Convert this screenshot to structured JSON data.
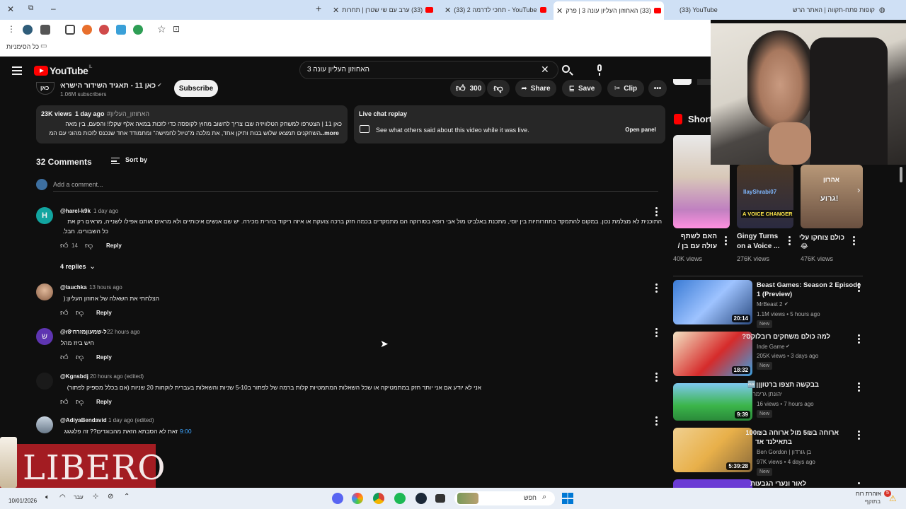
{
  "browser": {
    "tabs": [
      {
        "label": "קופות פתח-תקווה | האתר הרש"
      },
      {
        "label": "(33) YouTube"
      },
      {
        "label": "(33) האחוזון העליון עונה 3 | פרק"
      },
      {
        "label": "(33) תחכי לדרמה 2 - YouTube"
      },
      {
        "label": "(33) ערב עם שי שטרן | תחרות"
      }
    ],
    "bookmarks_label": "כל הסימניות"
  },
  "youtube": {
    "logo_text": "YouTube",
    "logo_region": "IL",
    "search_value": "האחוזון העליון עונה 3"
  },
  "channel": {
    "name": "כאן 11 - תאגיד השידור הישראלי",
    "subscribers": "1.06M subscribers",
    "subscribe_label": "Subscribe",
    "logo_text": "כאן"
  },
  "actions": {
    "likes": "300",
    "share": "Share",
    "save": "Save",
    "clip": "Clip"
  },
  "description": {
    "views": "23K views",
    "age": "1 day ago",
    "hashtag": "#האחוזון_העליון",
    "line1": "כאן 11 | הצטרפו למשחק הטלוויזיה שבו צריך לחשוב מחוץ לקופסה כדי לזכות במאה אלף שקל!! והפעם, בין מאה",
    "line2": "השחקנים תמצאו שלוש בנות ותיקן אחד, את מלכה מ\"טיול לחמישה\" ומתמודד אחד שנכנס לזכות מהוני עם המ",
    "more": "...more"
  },
  "live_chat": {
    "title": "Live chat replay",
    "text": "See what others said about this video while it was live.",
    "button": "Open panel"
  },
  "comments": {
    "count_label": "32 Comments",
    "sort_label": "Sort by",
    "add_placeholder": "Add a comment...",
    "reply_label": "Reply",
    "items": [
      {
        "author": "@harel-k9k",
        "age": "1 day ago",
        "avatar_letter": "H",
        "avatar_color": "#12a5a0",
        "text1": "התוכנית לא מצלמת נכון. במקום להתמקד בתחרותיות בין יוסי, מתכנת באלביט מול אבי רופא בסורוקה הם מתמקדים בכמה חזק ברכה צועקת או איזה ריקוד בהרית מכירה. יש שם אנשים איכותיים ולא מראים אותם אפילו לשנייה, מראים רק את",
        "text2": "כל השבורים. חבל.",
        "likes": "14",
        "replies": "4 replies"
      },
      {
        "author": "@lauchka",
        "age": "13 hours ago",
        "avatar_color": "#c89a7a",
        "text1": "הצלחתי את השאלה של אחוזון העליון:(",
        "likes": ""
      },
      {
        "author": "@r8ל-שמעוןמזרחי",
        "age": "22 hours ago",
        "avatar_letter": "ש",
        "avatar_color": "#5e35b1",
        "text1": "חיש ביזז מהל",
        "likes": ""
      },
      {
        "author": "@Kgnsbdj",
        "age": "20 hours ago (edited)",
        "avatar_color": "#1a1a1a",
        "text1": "אני לא יודע אם אני יותר חזק במתמטיקה או שכל השאלות המתמטיות קלות ברמה של לפתור ב5-10 שניות והשאלות בעברית לוקחות 20 שניות (אם בכלל מספיק לפתור)",
        "likes": ""
      },
      {
        "author": "@AdiyaBendavid",
        "age": "1 day ago (edited)",
        "avatar_color": "#7a8a9a",
        "text1": "זאת לא הסבתא הזאת מהבוגדים?? זה פלגגגג",
        "timestamp": "9:00"
      }
    ]
  },
  "shorts": {
    "title": "Shorts",
    "items": [
      {
        "title1": "האם לשתף",
        "title2": "עולה עם בן /",
        "views": "40K views"
      },
      {
        "title1": "Gingy Turns",
        "title2": "on a Voice ...",
        "views": "276K views"
      },
      {
        "title1": "כולם צוחקו עלי",
        "title2": "😂",
        "views": "476K views"
      }
    ],
    "overlay_text": "A VOICE CHANGER",
    "overlay_name": "IlayShrabi07",
    "overlay_heb": "אהרון",
    "overlay_wow": "גרוע!"
  },
  "recommended": [
    {
      "title1": "Beast Games: Season 2 Episode",
      "title2": "1 (Preview)",
      "channel": "MrBeast 2",
      "meta": "1.1M views • 5 hours ago",
      "new": "New",
      "duration": "20:14",
      "thumb_color": "#3a7bd5"
    },
    {
      "title1": "למה כולם משחקים רובלוקס?",
      "title2": "",
      "channel": "Inde Game",
      "meta": "205K views • 3 days ago",
      "new": "New",
      "duration": "18:32",
      "thumb_color": "#d62b2b"
    },
    {
      "title1": "בבקשה תצפו ברטוןןן🆓",
      "title2": "",
      "channel": "יהונתן גרימר",
      "meta": "16 views • 7 hours ago",
      "new": "New",
      "duration": "9:39",
      "thumb_color": "#3bb54a"
    },
    {
      "title1": "ארוחה ב5₪ מול ארוחה ב100₪",
      "title2": "בתאילנד אד",
      "channel": "Ben Gordon | בן גורדון",
      "meta": "97K views • 4 days ago",
      "new": "New",
      "duration": "5:39:28",
      "thumb_color": "#e8b04a"
    },
    {
      "title1": "לאור ונערי הגבעות",
      "title2": "",
      "channel": "",
      "meta": "",
      "new": "",
      "duration": "",
      "thumb_color": "#6a3bd5"
    }
  ],
  "overlay": {
    "libero": "LIBERO"
  },
  "taskbar": {
    "date": "10/01/2026",
    "lang": "עבר",
    "search": "חפש",
    "weather1": "אזהרת רוח",
    "weather2": "בתוקף",
    "notif": "5"
  }
}
